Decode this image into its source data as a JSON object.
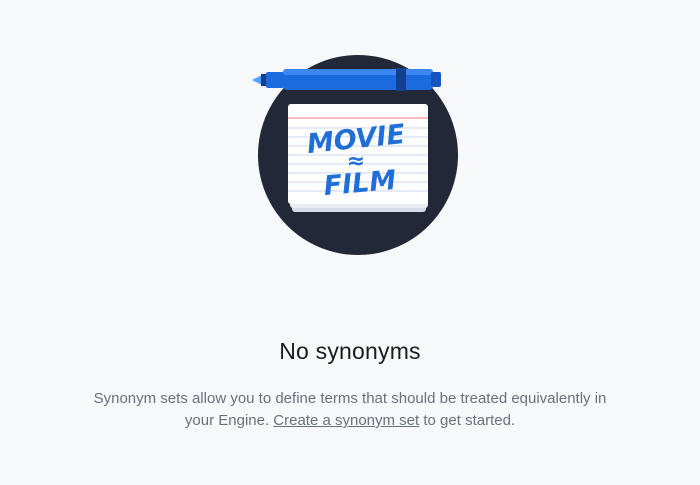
{
  "illustration": {
    "card_line1": "MOVIE",
    "card_line2": "≈",
    "card_line3": "FILM",
    "colors": {
      "circle": "#232838",
      "card": "#ffffff",
      "card_lines": "#c9d4f0",
      "card_red_line": "#f2a7a7",
      "ink": "#1f6fd6",
      "marker": "#1b6ae0",
      "marker_dark": "#123f8f"
    }
  },
  "empty_state": {
    "title": "No synonyms",
    "body_before": "Synonym sets allow you to define terms that should be treated equivalently in your Engine. ",
    "link_label": "Create a synonym set",
    "body_after": " to get started."
  }
}
